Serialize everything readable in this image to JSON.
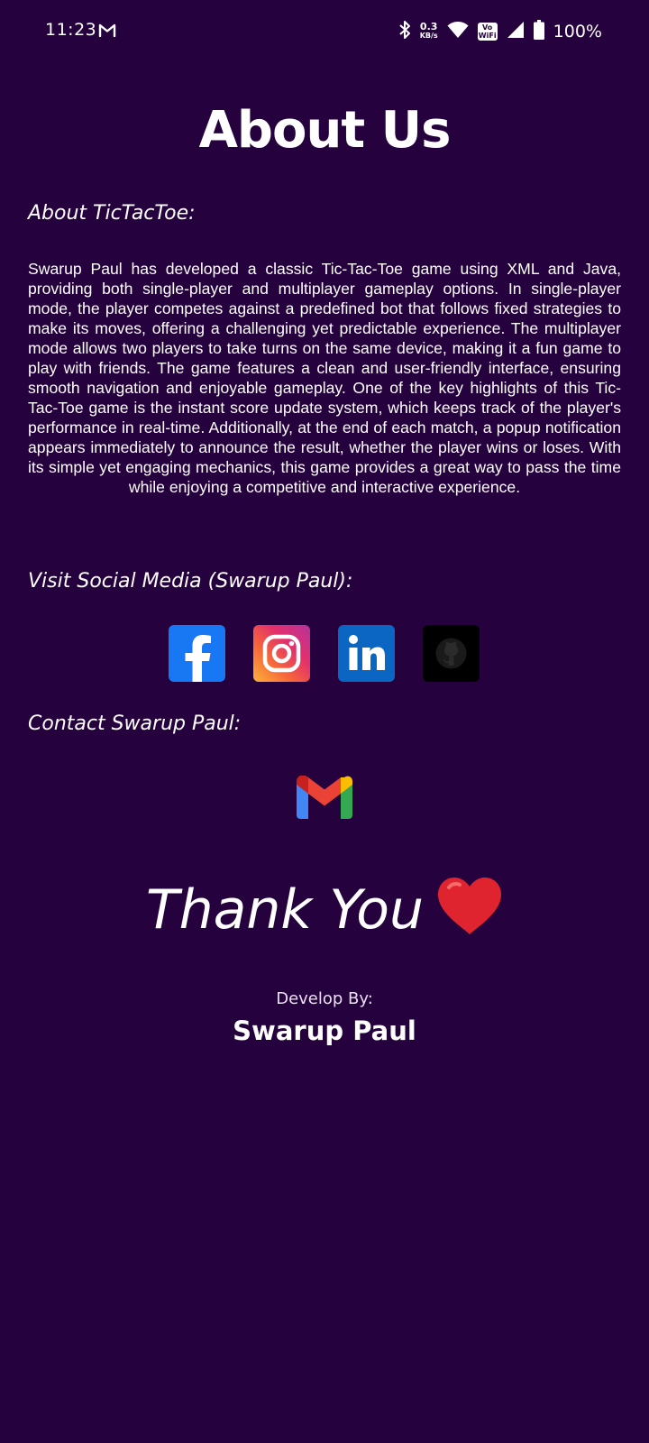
{
  "status_bar": {
    "time": "11:23",
    "speed_value": "0.3",
    "speed_unit": "KB/s",
    "vowifi_line1": "Vo",
    "vowifi_line2": "WiFi",
    "battery": "100%",
    "icons": [
      "gmail-icon",
      "bluetooth-icon",
      "wifi-icon",
      "signal-icon",
      "battery-icon"
    ]
  },
  "page": {
    "title": "About Us",
    "about_heading": "About TicTacToe:",
    "about_text": "Swarup Paul has developed a classic Tic-Tac-Toe game using XML and Java, providing both single-player and multiplayer gameplay options. In single-player mode, the player competes against a predefined bot that follows fixed strategies to make its moves, offering a challenging yet predictable experience. The multiplayer mode allows two players to take turns on the same device, making it a fun game to play with friends. The game features a clean and user-friendly interface, ensuring smooth navigation and enjoyable gameplay. One of the key highlights of this Tic-Tac-Toe game is the instant score update system, which keeps track of the player's performance in real-time. Additionally, at the end of each match, a popup notification appears immediately to announce the result, whether the player wins or loses. With its simple yet engaging mechanics, this game provides a great way to pass the time while enjoying a competitive and interactive experience.",
    "social_heading": "Visit Social Media (Swarup Paul):",
    "social_links": [
      "facebook-icon",
      "instagram-icon",
      "linkedin-icon",
      "github-icon"
    ],
    "contact_heading": "Contact Swarup Paul:",
    "contact_icon": "gmail-icon",
    "thank_you": "Thank You",
    "develop_by_label": "Develop By:",
    "developer_name": "Swarup Paul"
  },
  "colors": {
    "background": "#25023d",
    "text": "#ffffff"
  }
}
